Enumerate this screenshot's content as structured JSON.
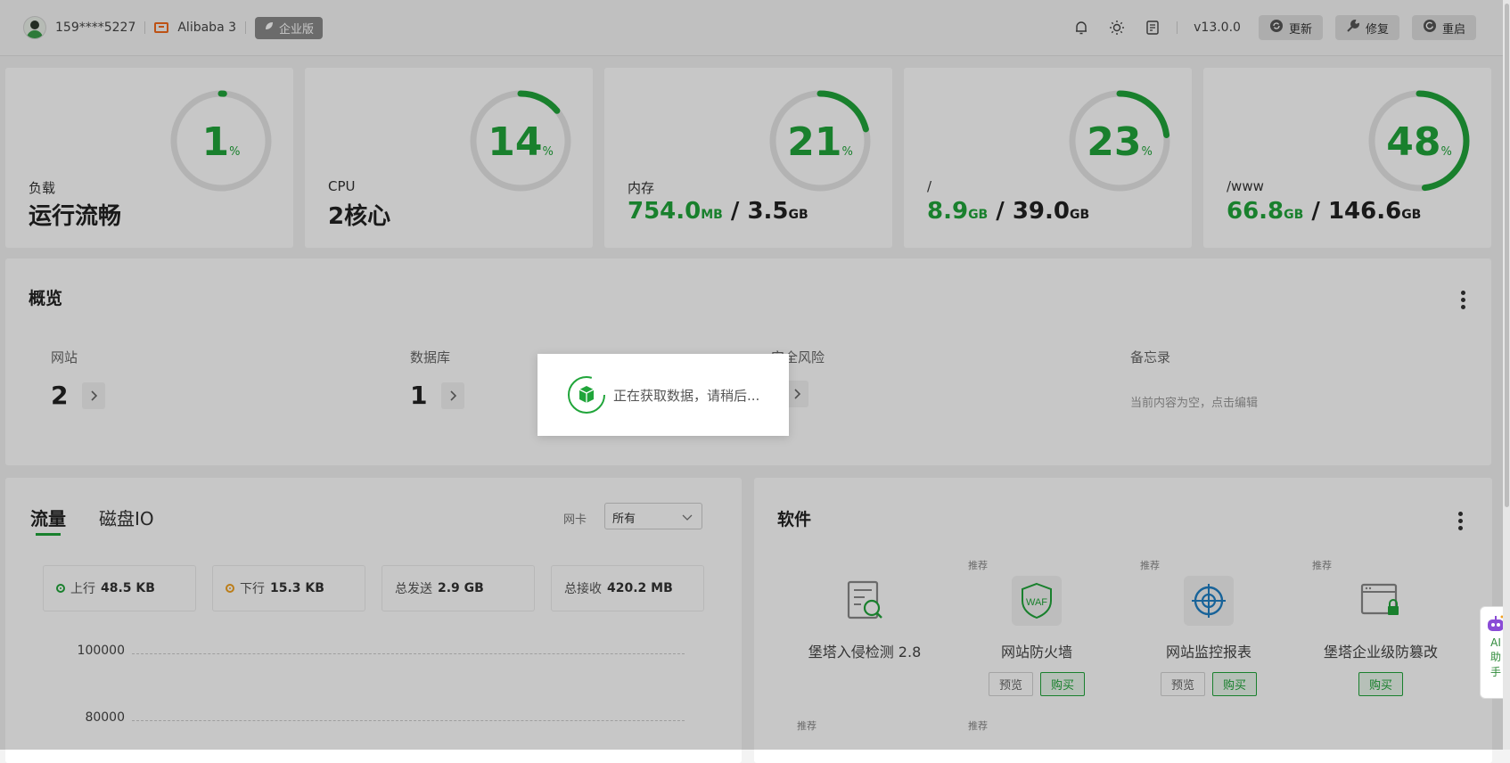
{
  "topbar": {
    "user": "159****5227",
    "server": "Alibaba 3",
    "edition": "企业版",
    "version": "v13.0.0",
    "icons": [
      "bell-icon",
      "sun-icon",
      "notes-icon"
    ],
    "buttons": [
      {
        "label": "更新",
        "icon": "refresh-icon"
      },
      {
        "label": "修复",
        "icon": "wrench-icon"
      },
      {
        "label": "重启",
        "icon": "restart-icon"
      }
    ]
  },
  "stats": [
    {
      "value": "1",
      "pct_sign": "%",
      "percent": 1,
      "label": "负载",
      "main": "运行流畅"
    },
    {
      "value": "14",
      "pct_sign": "%",
      "percent": 14,
      "label": "CPU",
      "main": "2核心"
    },
    {
      "value": "21",
      "pct_sign": "%",
      "percent": 21,
      "label": "内存",
      "used": "754.0",
      "used_unit": "MB",
      "slash": " / ",
      "total": "3.5",
      "total_unit": "GB"
    },
    {
      "value": "23",
      "pct_sign": "%",
      "percent": 23,
      "label": "/",
      "used": "8.9",
      "used_unit": "GB",
      "slash": " / ",
      "total": "39.0",
      "total_unit": "GB"
    },
    {
      "value": "48",
      "pct_sign": "%",
      "percent": 48,
      "label": "/www",
      "used": "66.8",
      "used_unit": "GB",
      "slash": " / ",
      "total": "146.6",
      "total_unit": "GB"
    }
  ],
  "overview": {
    "title": "概览",
    "items": [
      {
        "label": "网站",
        "value": "2"
      },
      {
        "label": "数据库",
        "value": "1"
      },
      {
        "label": "安全风险",
        "value": ""
      }
    ],
    "memo": {
      "label": "备忘录",
      "hint": "当前内容为空，点击编辑"
    }
  },
  "traffic": {
    "tabs": [
      "流量",
      "磁盘IO"
    ],
    "nic_label": "网卡",
    "nic_value": "所有",
    "stats": [
      {
        "label": "上行",
        "value": "48.5 KB",
        "color": "#20a53a"
      },
      {
        "label": "下行",
        "value": "15.3 KB",
        "color": "#f0a020"
      },
      {
        "label": "总发送",
        "value": "2.9 GB"
      },
      {
        "label": "总接收",
        "value": "420.2 MB"
      }
    ],
    "y_ticks": [
      "100000",
      "80000"
    ]
  },
  "software": {
    "title": "软件",
    "recommend_label": "推荐",
    "items": [
      {
        "name": "堡塔入侵检测 2.8",
        "icon": "intrusion-detection-icon"
      },
      {
        "name": "网站防火墙",
        "icon": "waf-shield-icon",
        "icon_text": "WAF",
        "preview": "预览",
        "buy": "购买"
      },
      {
        "name": "网站监控报表",
        "icon": "monitor-target-icon",
        "preview": "预览",
        "buy": "购买"
      },
      {
        "name": "堡塔企业级防篡改",
        "icon": "tamper-lock-icon",
        "buy": "购买"
      }
    ]
  },
  "loading": {
    "message": "正在获取数据，请稍后..."
  },
  "ai_assistant": {
    "label": "AI助手",
    "line1": "AI",
    "line2": "助",
    "line3": "手"
  }
}
